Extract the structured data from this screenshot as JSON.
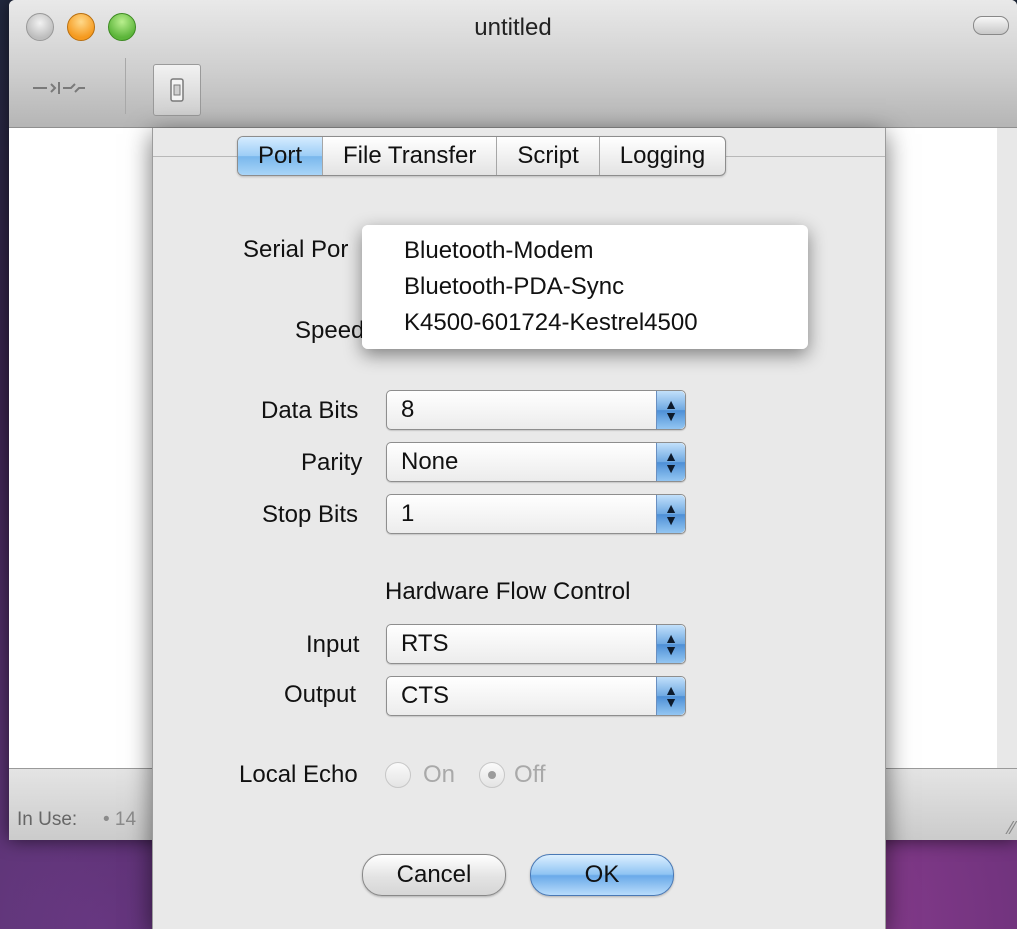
{
  "window": {
    "title": "untitled",
    "status": {
      "label": "In Use:",
      "value": "• 14"
    }
  },
  "sheet": {
    "tabs": [
      {
        "label": "Port",
        "active": true
      },
      {
        "label": "File Transfer",
        "active": false
      },
      {
        "label": "Script",
        "active": false
      },
      {
        "label": "Logging",
        "active": false
      }
    ],
    "serial_port": {
      "label": "Serial Por"
    },
    "speed": {
      "label": "Speed"
    },
    "data_bits": {
      "label": "Data Bits",
      "value": "8"
    },
    "parity": {
      "label": "Parity",
      "value": "None"
    },
    "stop_bits": {
      "label": "Stop Bits",
      "value": "1"
    },
    "flow_control": {
      "title": "Hardware Flow Control",
      "input": {
        "label": "Input",
        "value": "RTS"
      },
      "output": {
        "label": "Output",
        "value": "CTS"
      }
    },
    "local_echo": {
      "label": "Local Echo",
      "options": [
        {
          "label": "On",
          "selected": false
        },
        {
          "label": "Off",
          "selected": true
        }
      ]
    },
    "buttons": {
      "cancel": "Cancel",
      "ok": "OK"
    }
  },
  "serial_port_menu": {
    "items": [
      "Bluetooth-Modem",
      "Bluetooth-PDA-Sync",
      "K4500-601724-Kestrel4500"
    ]
  },
  "colors": {
    "selection_blue": "#79b7ec",
    "sheet_bg": "#e9e9e9"
  }
}
